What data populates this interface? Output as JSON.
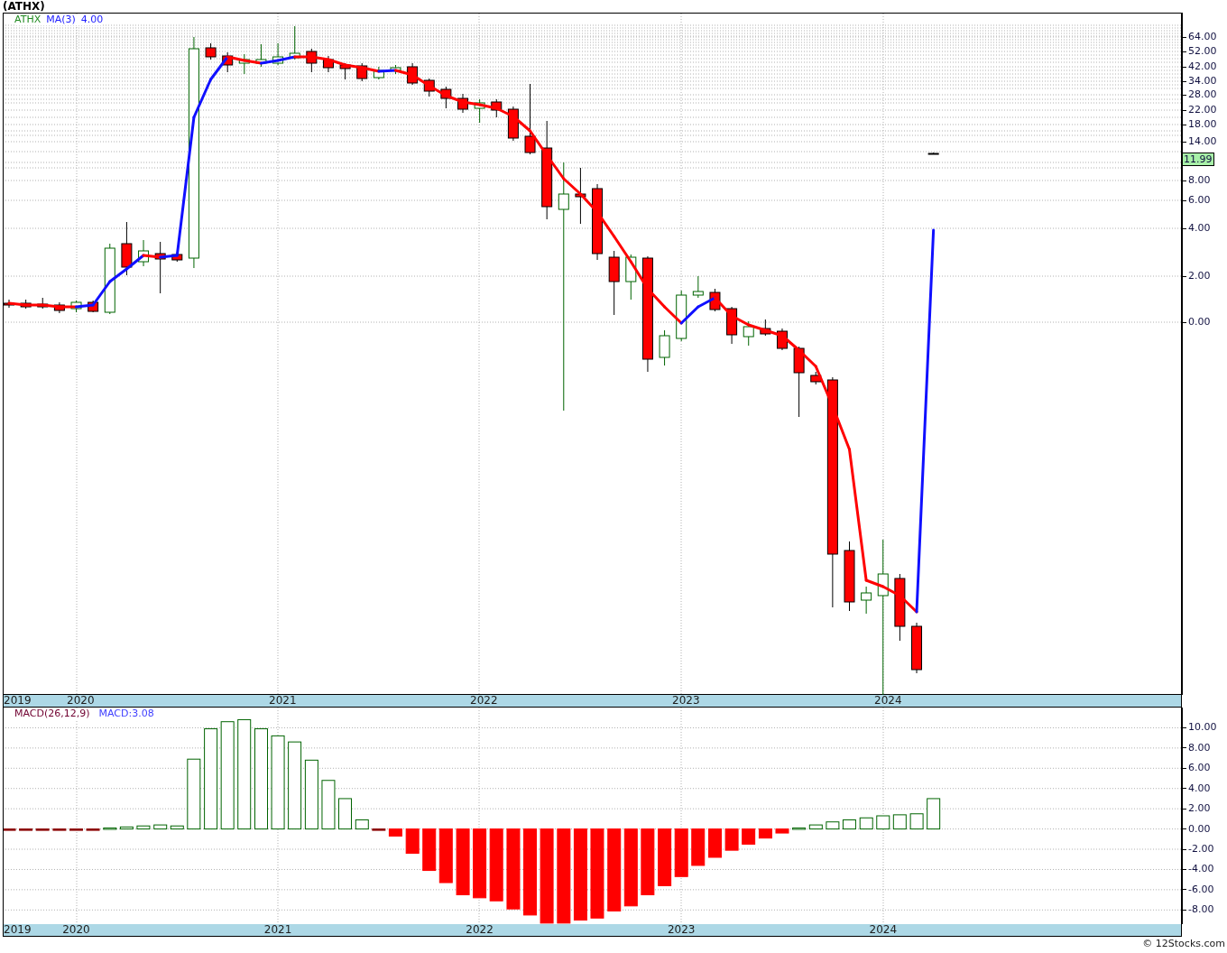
{
  "title": "(ATHX)",
  "legend": {
    "symbol": "ATHX",
    "indicator": "MA(3)",
    "value": "4.00"
  },
  "price_axis": {
    "labels": [
      "64.00",
      "52.00",
      "42.00",
      "34.00",
      "28.00",
      "22.00",
      "18.00",
      "14.00",
      "8.00",
      "6.00",
      "4.00",
      "2.00",
      "0.00"
    ],
    "last_price": "11.99"
  },
  "date_axis": [
    "2019",
    "2020",
    "2021",
    "2022",
    "2023",
    "2024"
  ],
  "macd": {
    "legend": "MACD(26,12,9)",
    "value": "MACD:3.08",
    "chart_data": {
      "type": "bar",
      "ylim": [
        -9.4,
        12
      ],
      "xlim": [
        2019.64,
        2025.486
      ],
      "grid": true,
      "xticks": [
        2020,
        2021,
        2022,
        2023,
        2024
      ],
      "x": [
        2019.667,
        2019.75,
        2019.833,
        2019.917,
        2020,
        2020.083,
        2020.167,
        2020.25,
        2020.333,
        2020.417,
        2020.5,
        2020.583,
        2020.667,
        2020.75,
        2020.833,
        2020.917,
        2021,
        2021.083,
        2021.167,
        2021.25,
        2021.333,
        2021.417,
        2021.5,
        2021.583,
        2021.667,
        2021.75,
        2021.833,
        2021.917,
        2022,
        2022.083,
        2022.167,
        2022.25,
        2022.333,
        2022.417,
        2022.5,
        2022.583,
        2022.667,
        2022.75,
        2022.833,
        2022.917,
        2023,
        2023.083,
        2023.167,
        2023.25,
        2023.333,
        2023.417,
        2023.5,
        2023.583,
        2023.667,
        2023.75,
        2023.833,
        2023.917,
        2024,
        2024.083,
        2024.167,
        2024.25
      ],
      "yticks": [
        {
          "value": 10,
          "label": "10.00"
        },
        {
          "value": 8,
          "label": "8.00"
        },
        {
          "value": 6,
          "label": "6.00"
        },
        {
          "value": 4,
          "label": "4.00"
        },
        {
          "value": 2,
          "label": "2.00"
        },
        {
          "value": 0,
          "label": "0.00"
        },
        {
          "value": -2,
          "label": "-2.00"
        },
        {
          "value": -4,
          "label": "-4.00"
        },
        {
          "value": -6,
          "label": "-6.00"
        },
        {
          "value": -8,
          "label": "-8.00"
        }
      ],
      "values": [
        -0.1,
        -0.1,
        -0.1,
        -0.1,
        -0.1,
        -0.1,
        0.1,
        0.2,
        0.3,
        0.4,
        0.3,
        6.9,
        9.9,
        10.6,
        10.8,
        9.9,
        9.2,
        8.6,
        6.8,
        4.8,
        3.0,
        0.9,
        -0.1,
        -0.7,
        -2.4,
        -4.1,
        -5.3,
        -6.5,
        -6.8,
        -7.1,
        -7.9,
        -8.5,
        -9.3,
        -9.3,
        -9.0,
        -8.8,
        -8.1,
        -7.6,
        -6.5,
        -5.6,
        -4.7,
        -3.6,
        -2.8,
        -2.1,
        -1.5,
        -0.9,
        -0.4,
        0.1,
        0.4,
        0.7,
        0.9,
        1.1,
        1.3,
        1.4,
        1.5,
        3.0
      ]
    }
  },
  "macd_date_axis": {
    "start_label": "2019"
  },
  "credit": "© 12Stocks.com"
}
